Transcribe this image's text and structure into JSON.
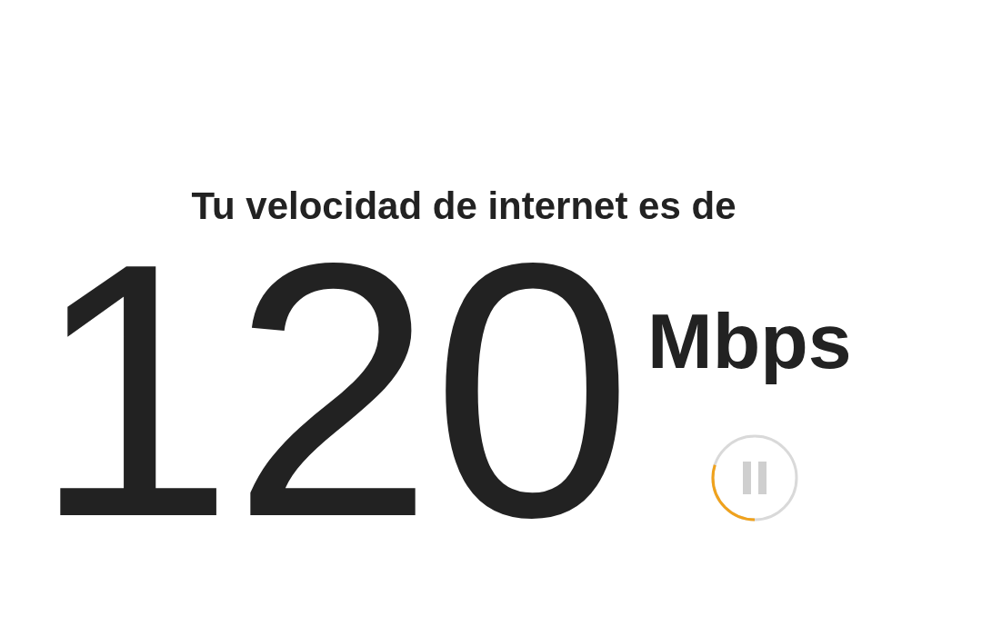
{
  "heading": "Tu velocidad de internet es de",
  "speed": {
    "value": "120",
    "unit": "Mbps"
  }
}
